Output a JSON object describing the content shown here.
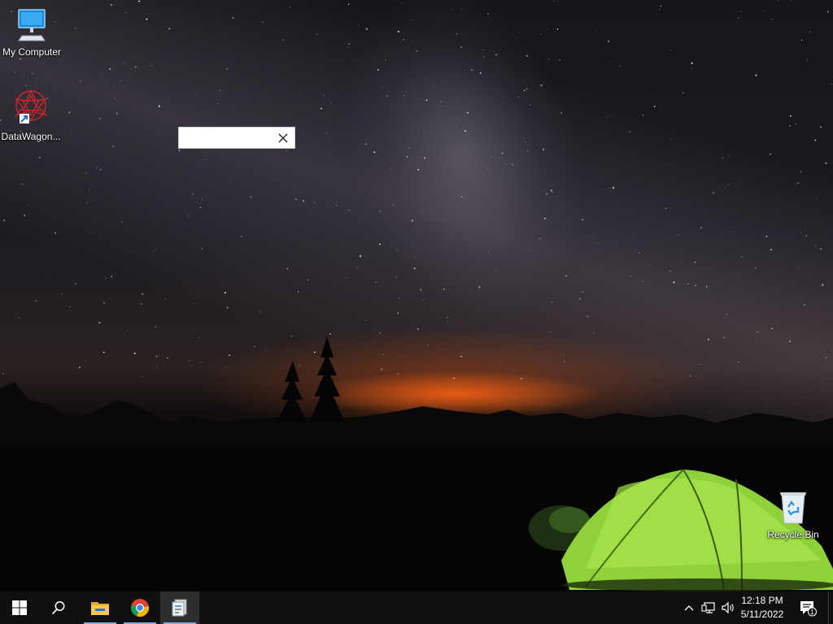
{
  "desktop": {
    "icons": [
      {
        "id": "my-computer",
        "label": "My Computer"
      },
      {
        "id": "datawagon",
        "label": "DataWagon..."
      },
      {
        "id": "recycle-bin",
        "label": "Recycle Bin"
      }
    ]
  },
  "popup": {
    "text": "",
    "close_icon": "close-icon"
  },
  "taskbar": {
    "start_icon": "windows-start-icon",
    "search_icon": "search-icon",
    "pinned": [
      {
        "name": "file-explorer",
        "icon": "folder-icon",
        "active": true
      },
      {
        "name": "chrome",
        "icon": "chrome-icon",
        "active": true
      },
      {
        "name": "app",
        "icon": "app-window-icon",
        "active": true
      }
    ],
    "tray": {
      "chevron_icon": "chevron-up-icon",
      "network_icon": "network-icon",
      "volume_icon": "volume-icon",
      "time": "12:18 PM",
      "date": "5/11/2022",
      "notification_count": "1"
    },
    "accent": "#7aaee6"
  }
}
